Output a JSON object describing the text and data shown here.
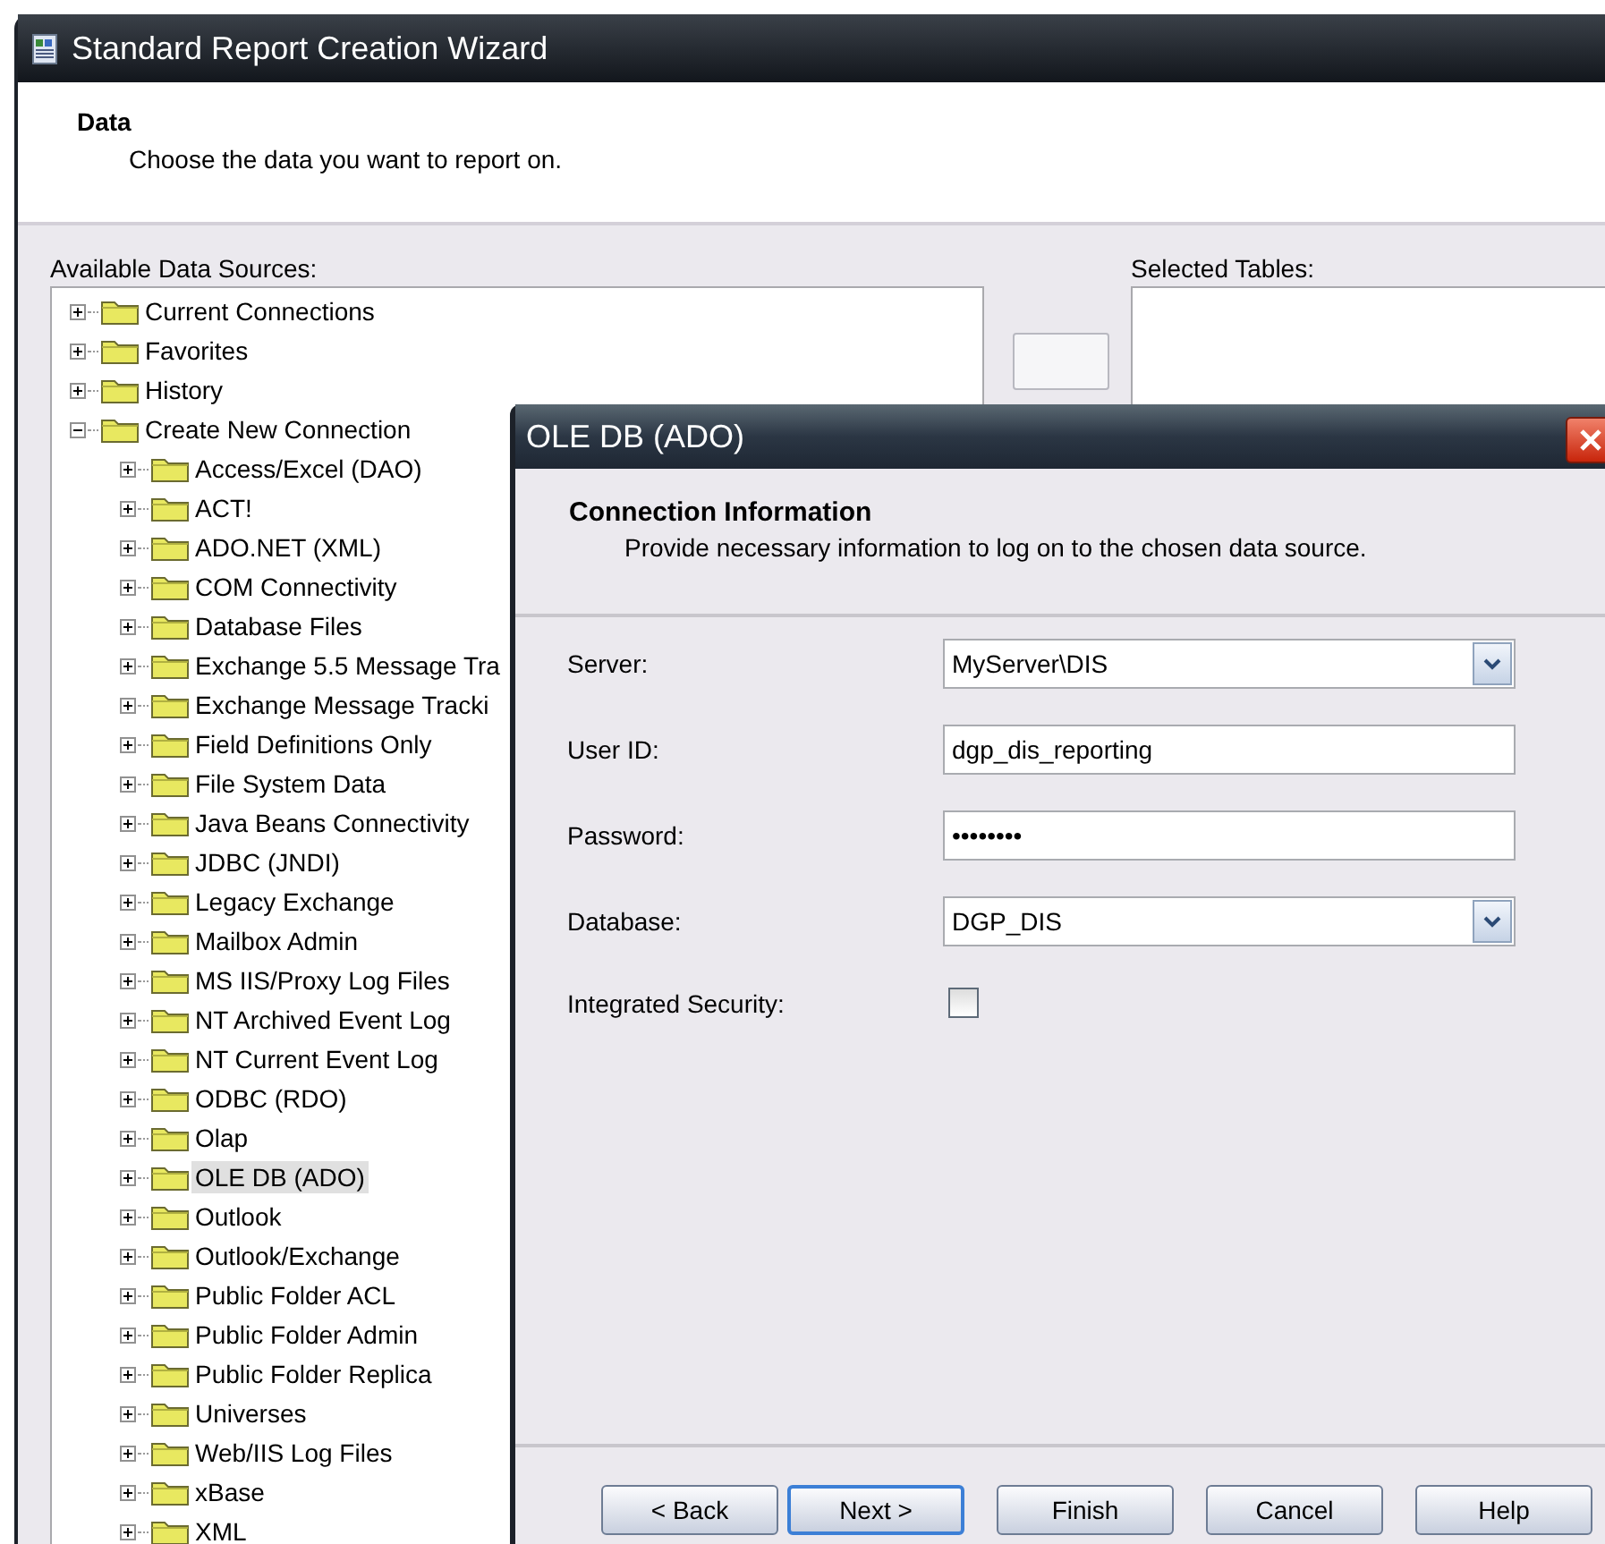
{
  "window": {
    "title": "Standard Report Creation Wizard"
  },
  "header": {
    "title": "Data",
    "subtitle": "Choose the data you want to report on."
  },
  "available_label": "Available Data Sources:",
  "selected_label": "Selected Tables:",
  "tree": [
    {
      "label": "Current Connections",
      "expanded": false,
      "selected": false
    },
    {
      "label": "Favorites",
      "expanded": false,
      "selected": false
    },
    {
      "label": "History",
      "expanded": false,
      "selected": false
    },
    {
      "label": "Create New Connection",
      "expanded": true,
      "selected": false,
      "children": [
        {
          "label": "Access/Excel (DAO)",
          "expanded": false,
          "selected": false
        },
        {
          "label": "ACT!",
          "expanded": false,
          "selected": false
        },
        {
          "label": "ADO.NET (XML)",
          "expanded": false,
          "selected": false
        },
        {
          "label": "COM Connectivity",
          "expanded": false,
          "selected": false
        },
        {
          "label": "Database Files",
          "expanded": false,
          "selected": false
        },
        {
          "label": "Exchange 5.5 Message Tra",
          "expanded": false,
          "selected": false
        },
        {
          "label": "Exchange Message Tracki",
          "expanded": false,
          "selected": false
        },
        {
          "label": "Field Definitions Only",
          "expanded": false,
          "selected": false
        },
        {
          "label": "File System Data",
          "expanded": false,
          "selected": false
        },
        {
          "label": "Java Beans Connectivity",
          "expanded": false,
          "selected": false
        },
        {
          "label": "JDBC (JNDI)",
          "expanded": false,
          "selected": false
        },
        {
          "label": "Legacy Exchange",
          "expanded": false,
          "selected": false
        },
        {
          "label": "Mailbox Admin",
          "expanded": false,
          "selected": false
        },
        {
          "label": "MS IIS/Proxy Log Files",
          "expanded": false,
          "selected": false
        },
        {
          "label": "NT Archived Event Log",
          "expanded": false,
          "selected": false
        },
        {
          "label": "NT Current Event Log",
          "expanded": false,
          "selected": false
        },
        {
          "label": "ODBC (RDO)",
          "expanded": false,
          "selected": false
        },
        {
          "label": "Olap",
          "expanded": false,
          "selected": false
        },
        {
          "label": "OLE DB (ADO)",
          "expanded": false,
          "selected": true
        },
        {
          "label": "Outlook",
          "expanded": false,
          "selected": false
        },
        {
          "label": "Outlook/Exchange",
          "expanded": false,
          "selected": false
        },
        {
          "label": "Public Folder ACL",
          "expanded": false,
          "selected": false
        },
        {
          "label": "Public Folder Admin",
          "expanded": false,
          "selected": false
        },
        {
          "label": "Public Folder Replica",
          "expanded": false,
          "selected": false
        },
        {
          "label": "Universes",
          "expanded": false,
          "selected": false
        },
        {
          "label": "Web/IIS Log Files",
          "expanded": false,
          "selected": false
        },
        {
          "label": "xBase",
          "expanded": false,
          "selected": false
        },
        {
          "label": "XML",
          "expanded": false,
          "selected": false
        }
      ]
    }
  ],
  "dialog": {
    "title": "OLE DB (ADO)",
    "header": {
      "title": "Connection Information",
      "subtitle": "Provide necessary information to log on to the chosen data source."
    },
    "fields": [
      {
        "kind": "combo",
        "label": "Server:",
        "value": "MyServer\\DIS"
      },
      {
        "kind": "text",
        "label": "User ID:",
        "value": "dgp_dis_reporting"
      },
      {
        "kind": "password",
        "label": "Password:",
        "value": "••••••••"
      },
      {
        "kind": "combo",
        "label": "Database:",
        "value": "DGP_DIS"
      },
      {
        "kind": "checkbox",
        "label": "Integrated Security:",
        "checked": false
      }
    ],
    "buttons": [
      {
        "label": "< Back",
        "default": false
      },
      {
        "label": "Next >",
        "default": true
      },
      {
        "label": "Finish",
        "default": false
      },
      {
        "label": "Cancel",
        "default": false
      },
      {
        "label": "Help",
        "default": false
      }
    ]
  }
}
